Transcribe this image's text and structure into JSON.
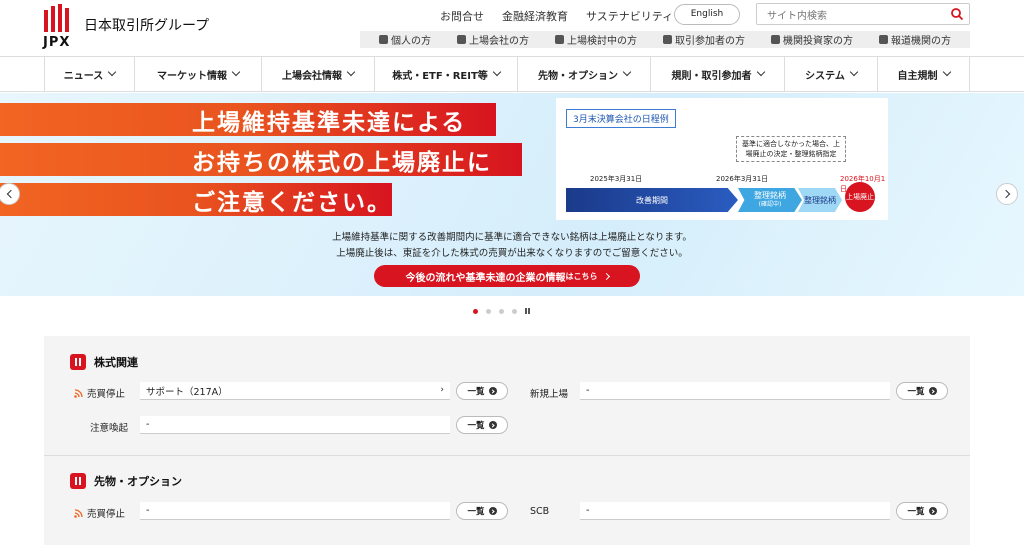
{
  "header": {
    "logo_text": "JPX",
    "group_name": "日本取引所グループ",
    "top_links": [
      "お問合せ",
      "金融経済教育",
      "サステナビリティ"
    ],
    "english_label": "English",
    "search_placeholder": "サイト内検索",
    "audiences": [
      "個人の方",
      "上場会社の方",
      "上場検討中の方",
      "取引参加者の方",
      "機関投資家の方",
      "報道機関の方"
    ]
  },
  "nav": {
    "items": [
      "ニュース",
      "マーケット情報",
      "上場会社情報",
      "株式・ETF・REIT等",
      "先物・オプション",
      "規則・取引参加者",
      "システム",
      "自主規制"
    ]
  },
  "banner": {
    "headline": [
      "上場維持基準未達による",
      "お持ちの株式の上場廃止に",
      "ご注意ください。"
    ],
    "schedule_title": "3月末決算会社の日程例",
    "schedule_note": "基準に適合しなかった場合、上場廃止の決定・整理銘柄指定",
    "dates": [
      "2025年3月31日",
      "2026年3月31日",
      "2026年10月1日"
    ],
    "phases": [
      "改善期間",
      "整理銘柄",
      "(確認中)",
      "整理銘柄"
    ],
    "end_label": "上場廃止",
    "description": [
      "上場維持基準に関する改善期間内に基準に適合できない銘柄は上場廃止となります。",
      "上場廃止後は、東証を介した株式の売買が出来なくなりますのでご留意ください。"
    ],
    "cta_main": "今後の流れや基準未達の企業の情報",
    "cta_small": "はこちら",
    "slide_count": 5,
    "active_slide": 1
  },
  "stocks": {
    "title": "株式関連",
    "suspension_label": "売買停止",
    "suspension_value": "サポート（217A）",
    "new_listing_label": "新規上場",
    "new_listing_value": "-",
    "alert_label": "注意喚起",
    "alert_value": "-",
    "list_label": "一覧"
  },
  "futures": {
    "title": "先物・オプション",
    "suspension_label": "売買停止",
    "suspension_value": "-",
    "scb_label": "SCB",
    "scb_value": "-",
    "list_label": "一覧"
  },
  "colors": {
    "accent": "#d7141f",
    "orange": "#f26522",
    "navy": "#1b3a8a",
    "sky": "#3ea6e0"
  }
}
